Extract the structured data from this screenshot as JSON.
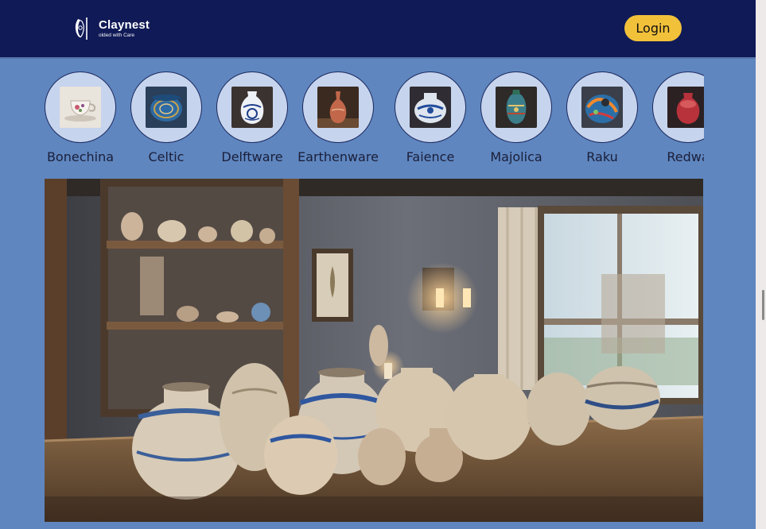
{
  "brand": {
    "name": "Claynest",
    "tagline": "olded with Care"
  },
  "header": {
    "login_label": "Login"
  },
  "categories": [
    {
      "label": "Bonechina",
      "icon": "teacup-image"
    },
    {
      "label": "Celtic",
      "icon": "celtic-bowl-image"
    },
    {
      "label": "Delftware",
      "icon": "delft-vase-image"
    },
    {
      "label": "Earthenware",
      "icon": "earthen-vase-image"
    },
    {
      "label": "Faience",
      "icon": "faience-vase-image"
    },
    {
      "label": "Majolica",
      "icon": "majolica-jar-image"
    },
    {
      "label": "Raku",
      "icon": "raku-pot-image"
    },
    {
      "label": "Redwa",
      "icon": "redware-pot-image"
    }
  ],
  "hero": {
    "image": "pottery-shelf-room-image"
  },
  "colors": {
    "header_bg": "#101a57",
    "page_bg": "#5f86bf",
    "login_bg": "#f2c13a"
  }
}
